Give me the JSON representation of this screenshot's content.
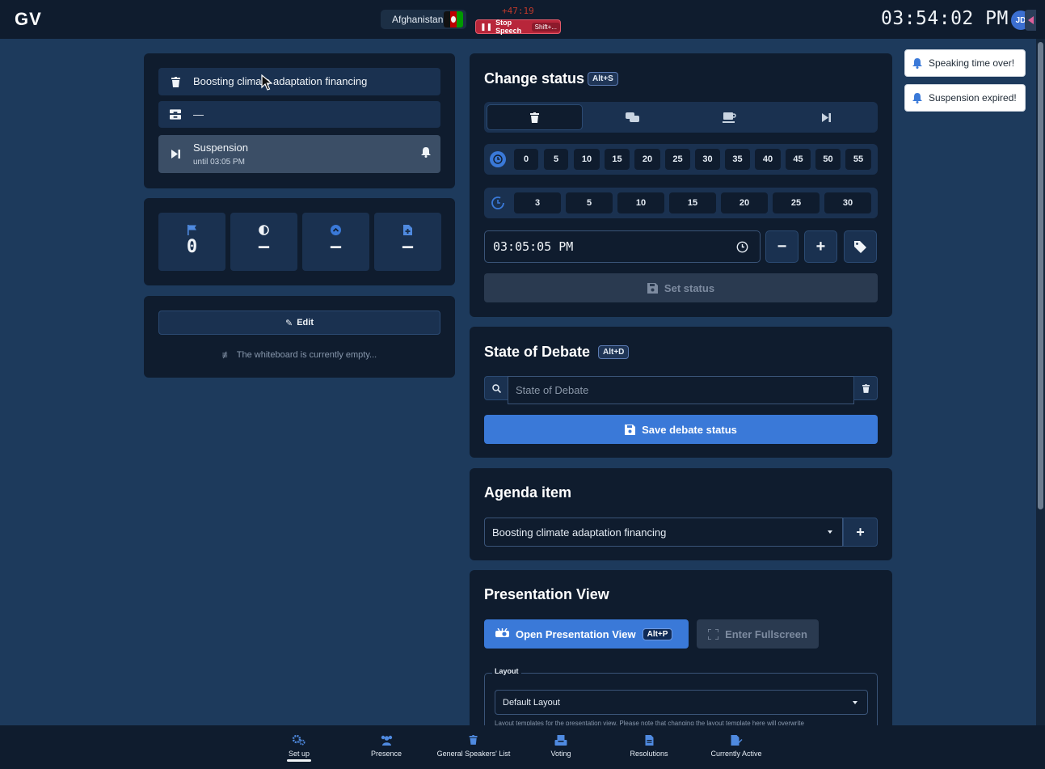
{
  "header": {
    "logo": "GV",
    "country": "Afghanistan",
    "timer_offset": "+47:19",
    "stop_speech_label": "Stop Speech",
    "stop_speech_shortcut": "Shift+...",
    "clock": "03:54:02 PM",
    "avatar_initials": "JD"
  },
  "left": {
    "speakers": [
      {
        "label": "Boosting climate adaptation financing",
        "icon": "trash-icon"
      },
      {
        "label": "—",
        "icon": "tray-icon"
      },
      {
        "label": "Suspension",
        "sub": "until 03:05 PM",
        "icon": "skip-icon"
      }
    ],
    "stats": [
      {
        "icon": "flag-icon",
        "value": "0"
      },
      {
        "icon": "half-circle-icon",
        "value": "—"
      },
      {
        "icon": "chevron-up-circle-icon",
        "value": "—"
      },
      {
        "icon": "file-plus-icon",
        "value": "—"
      }
    ],
    "whiteboard": {
      "edit_label": "Edit",
      "empty_text": "The whiteboard is currently empty..."
    }
  },
  "change_status": {
    "title": "Change status",
    "shortcut": "Alt+S",
    "tabs": [
      "speakers",
      "discussion",
      "break",
      "suspension"
    ],
    "minutes": [
      "0",
      "5",
      "10",
      "15",
      "20",
      "25",
      "30",
      "35",
      "40",
      "45",
      "50",
      "55"
    ],
    "durations": [
      "3",
      "5",
      "10",
      "15",
      "20",
      "25",
      "30"
    ],
    "time_value": "03:05:05 PM",
    "set_status_label": "Set status"
  },
  "state_of_debate": {
    "title": "State of Debate",
    "shortcut": "Alt+D",
    "placeholder": "State of Debate",
    "save_label": "Save debate status"
  },
  "agenda": {
    "title": "Agenda item",
    "selected": "Boosting climate adaptation financing"
  },
  "presentation": {
    "title": "Presentation View",
    "open_label": "Open Presentation View",
    "open_shortcut": "Alt+P",
    "fullscreen_label": "Enter Fullscreen",
    "layout_legend": "Layout",
    "layout_selected": "Default Layout",
    "layout_hint": "Layout templates for the presentation view. Please note that changing the layout template here will overwrite"
  },
  "toasts": [
    "Speaking time over!",
    "Suspension expired!"
  ],
  "bottom_nav": [
    {
      "label": "Set up",
      "active": true
    },
    {
      "label": "Presence",
      "active": false
    },
    {
      "label": "General Speakers' List",
      "active": false
    },
    {
      "label": "Voting",
      "active": false
    },
    {
      "label": "Resolutions",
      "active": false
    },
    {
      "label": "Currently Active",
      "active": false
    }
  ],
  "colors": {
    "background": "#1d3a5c",
    "card": "#0f1c2e",
    "accent": "#3a79d8",
    "danger": "#b8263a"
  }
}
